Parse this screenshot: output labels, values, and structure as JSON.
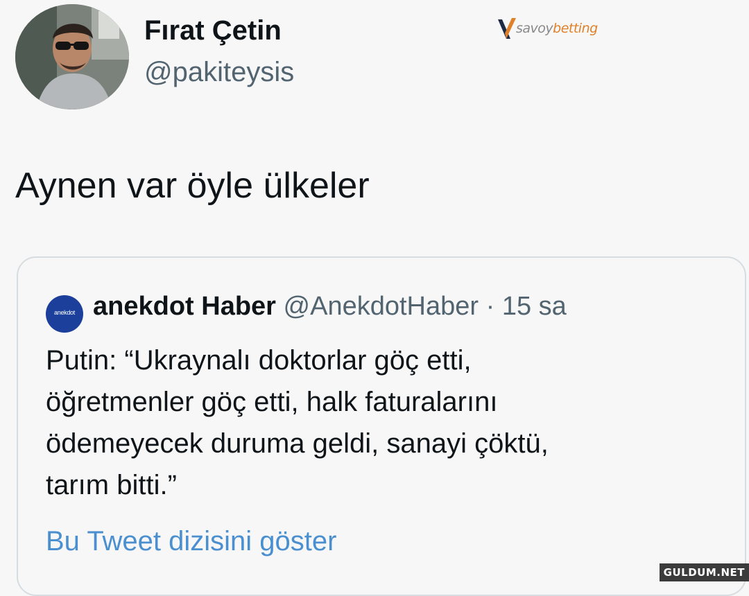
{
  "author": {
    "display_name": "Fırat Çetin",
    "handle": "@pakiteysis"
  },
  "tweet": {
    "text": "Aynen var öyle ülkeler"
  },
  "quoted_tweet": {
    "avatar_text": "anekdot",
    "display_name": "anekdot Haber",
    "handle": "@AnekdotHaber",
    "separator": "·",
    "time": "15 sa",
    "body_lines": [
      "Putin: “Ukraynalı doktorlar göç etti,",
      "öğretmenler göç etti, halk faturalarını",
      "ödemeyecek duruma geldi, sanayi çöktü,",
      "tarım bitti.”"
    ],
    "show_thread_label": "Bu Tweet dizisini göster"
  },
  "watermarks": {
    "brand_prefix": "savoy",
    "brand_suffix": "betting",
    "corner": "GULDUM.NET"
  },
  "colors": {
    "background": "#f7f7f7",
    "text_primary": "#0f1419",
    "text_secondary": "#536471",
    "link": "#4a8fcf",
    "card_border": "#d6dce0",
    "quote_avatar": "#1b3f9a"
  }
}
